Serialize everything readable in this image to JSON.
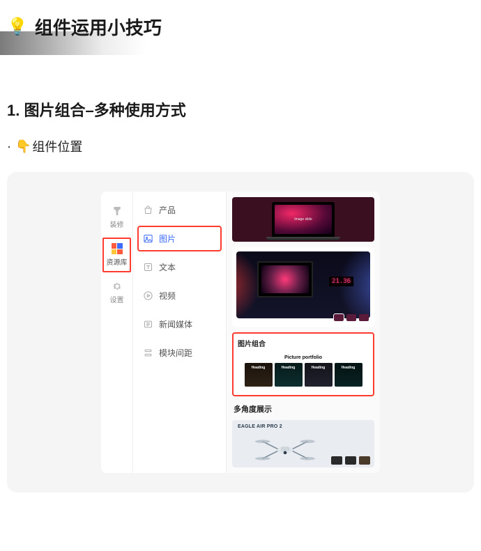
{
  "title": {
    "emoji": "💡",
    "text": "组件运用小技巧"
  },
  "section1": {
    "heading": "1. 图片组合–多种使用方式",
    "bullet_dot": "·",
    "bullet_emoji": "👇",
    "bullet_text": "组件位置"
  },
  "vnav": {
    "items": [
      {
        "id": "decorate",
        "label": "装修"
      },
      {
        "id": "resources",
        "label": "资源库"
      },
      {
        "id": "settings",
        "label": "设置"
      }
    ]
  },
  "cmenu": {
    "items": [
      {
        "id": "product",
        "label": "产品"
      },
      {
        "id": "image",
        "label": "图片"
      },
      {
        "id": "text",
        "label": "文本"
      },
      {
        "id": "video",
        "label": "视频"
      },
      {
        "id": "news",
        "label": "新闻媒体"
      },
      {
        "id": "spacing",
        "label": "模块间距"
      }
    ]
  },
  "preview": {
    "laptop_screen_text": "Image slide",
    "desk_clock": "21.36",
    "portfolio_block_title": "图片组合",
    "portfolio_heading": "Picture portfolio",
    "portfolio_card_label": "Heading",
    "multiangle_title": "多角度展示",
    "drone_title": "EAGLE AIR PRO 2"
  }
}
